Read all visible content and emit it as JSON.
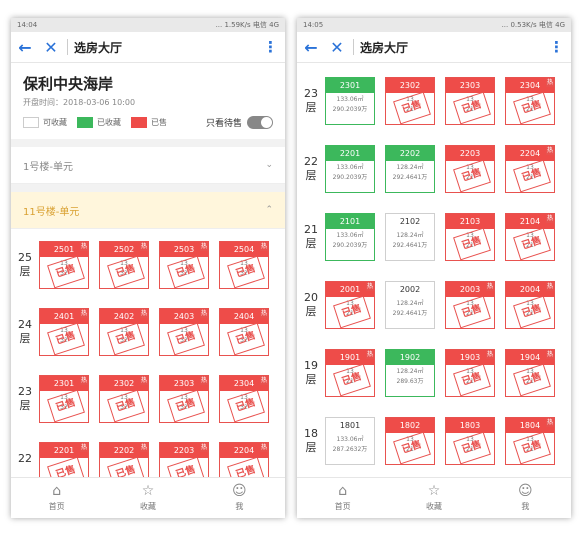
{
  "left": {
    "status": {
      "time": "14:04",
      "speed": "... 1.59K/s",
      "carrier": "电信 4G"
    },
    "appbar": {
      "title": "选房大厅"
    },
    "project": {
      "name": "保利中央海岸",
      "open_time": "开盘时间：2018-03-06 10:00"
    },
    "legend": {
      "available": "可收藏",
      "collected": "已收藏",
      "sold": "已售",
      "toggle_label": "只看待售"
    },
    "buildings": [
      {
        "label": "1号楼-单元"
      },
      {
        "label": "11号楼-单元"
      }
    ],
    "floors": [
      {
        "label": "25\n层",
        "units": [
          {
            "num": "2501",
            "area": "13",
            "price": "32"
          },
          {
            "num": "2502",
            "area": "13",
            "price": "32"
          },
          {
            "num": "2503",
            "area": "13",
            "price": "32"
          },
          {
            "num": "2504",
            "area": "13",
            "price": "32"
          }
        ]
      },
      {
        "label": "24\n层",
        "units": [
          {
            "num": "2401",
            "area": "13",
            "price": "32"
          },
          {
            "num": "2402",
            "area": "13",
            "price": "32"
          },
          {
            "num": "2403",
            "area": "13",
            "price": "32"
          },
          {
            "num": "2404",
            "area": "13",
            "price": "32"
          }
        ]
      },
      {
        "label": "23\n层",
        "units": [
          {
            "num": "2301",
            "area": "13",
            "price": "32"
          },
          {
            "num": "2302",
            "area": "13",
            "price": "32"
          },
          {
            "num": "2303",
            "area": "13",
            "price": "32"
          },
          {
            "num": "2304",
            "area": "13",
            "price": "32"
          }
        ]
      },
      {
        "label": "22",
        "units": [
          {
            "num": "2201",
            "area": "",
            "price": ""
          },
          {
            "num": "2202",
            "area": "",
            "price": ""
          },
          {
            "num": "2203",
            "area": "",
            "price": ""
          },
          {
            "num": "2204",
            "area": "",
            "price": ""
          }
        ]
      }
    ],
    "tabs": [
      {
        "label": "首页"
      },
      {
        "label": "收藏"
      },
      {
        "label": "我"
      }
    ]
  },
  "right": {
    "status": {
      "time": "14:05",
      "speed": "... 0.53K/s",
      "carrier": "电信 4G"
    },
    "appbar": {
      "title": "选房大厅"
    },
    "floors": [
      {
        "label": "23\n层",
        "units": [
          {
            "num": "2301",
            "area": "133.06㎡",
            "price": "290.2039万",
            "state": "green"
          },
          {
            "num": "2302",
            "area": "13",
            "price": "21",
            "state": "sold"
          },
          {
            "num": "2303",
            "area": "13",
            "price": "21",
            "state": "sold"
          },
          {
            "num": "2304",
            "area": "13",
            "price": "21",
            "state": "sold"
          }
        ]
      },
      {
        "label": "22\n层",
        "units": [
          {
            "num": "2201",
            "area": "133.06㎡",
            "price": "290.2039万",
            "state": "green"
          },
          {
            "num": "2202",
            "area": "128.24㎡",
            "price": "292.4641万",
            "state": "green"
          },
          {
            "num": "2203",
            "area": "13",
            "price": "21",
            "state": "sold"
          },
          {
            "num": "2204",
            "area": "13",
            "price": "21",
            "state": "sold"
          }
        ]
      },
      {
        "label": "21\n层",
        "units": [
          {
            "num": "2101",
            "area": "133.06㎡",
            "price": "290.2039万",
            "state": "green"
          },
          {
            "num": "2102",
            "area": "128.24㎡",
            "price": "292.4641万",
            "state": "white"
          },
          {
            "num": "2103",
            "area": "13",
            "price": "21",
            "state": "sold"
          },
          {
            "num": "2104",
            "area": "13",
            "price": "21",
            "state": "sold"
          }
        ]
      },
      {
        "label": "20\n层",
        "units": [
          {
            "num": "2001",
            "area": "13",
            "price": "21",
            "state": "sold"
          },
          {
            "num": "2002",
            "area": "128.24㎡",
            "price": "292.4641万",
            "state": "white"
          },
          {
            "num": "2003",
            "area": "13",
            "price": "21",
            "state": "sold"
          },
          {
            "num": "2004",
            "area": "13",
            "price": "21",
            "state": "sold"
          }
        ]
      },
      {
        "label": "19\n层",
        "units": [
          {
            "num": "1901",
            "area": "13",
            "price": "21",
            "state": "sold"
          },
          {
            "num": "1902",
            "area": "128.24㎡",
            "price": "289.63万",
            "state": "green"
          },
          {
            "num": "1903",
            "area": "13",
            "price": "21",
            "state": "sold"
          },
          {
            "num": "1904",
            "area": "13",
            "price": "21",
            "state": "sold"
          }
        ]
      },
      {
        "label": "18\n层",
        "units": [
          {
            "num": "1801",
            "area": "133.06㎡",
            "price": "287.2632万",
            "state": "white"
          },
          {
            "num": "1802",
            "area": "13",
            "price": "21",
            "state": "sold"
          },
          {
            "num": "1803",
            "area": "13",
            "price": "21",
            "state": "sold"
          },
          {
            "num": "1804",
            "area": "13",
            "price": "21",
            "state": "sold"
          }
        ]
      }
    ],
    "tabs": [
      {
        "label": "首页"
      },
      {
        "label": "收藏"
      },
      {
        "label": "我"
      }
    ]
  },
  "stamp_text": "已售",
  "tag_text": "热",
  "colors": {
    "sold": "#ee4c49",
    "collected": "#3cb85c",
    "accent": "#2a72d8",
    "active_building": "#fff6dc"
  }
}
